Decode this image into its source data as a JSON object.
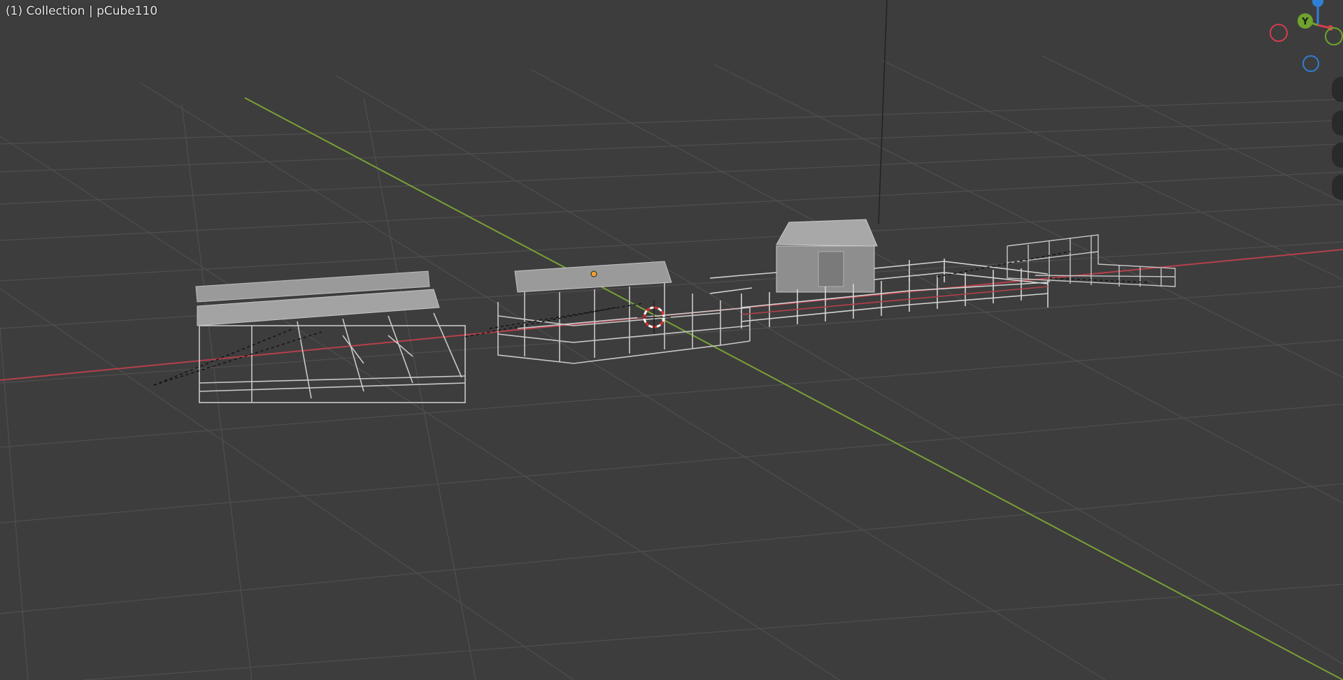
{
  "viewport": {
    "header_text": "(1) Collection | pCube110",
    "background": "#3d3d3d",
    "grid_color": "#4d4d4d",
    "x_axis_color": "#b5404a",
    "y_axis_color": "#7ba036",
    "wire_color": "#c8c8c8",
    "roof_color": "#9a9a9a",
    "origin_color": "#f0a030"
  },
  "gizmo": {
    "x_color": "#d13e4e",
    "y_color": "#6ea42c",
    "z_color": "#2f7fd6",
    "y_label": "Y",
    "icons": [
      "zoom-icon",
      "pan-icon",
      "camera-icon",
      "perspective-icon"
    ]
  }
}
